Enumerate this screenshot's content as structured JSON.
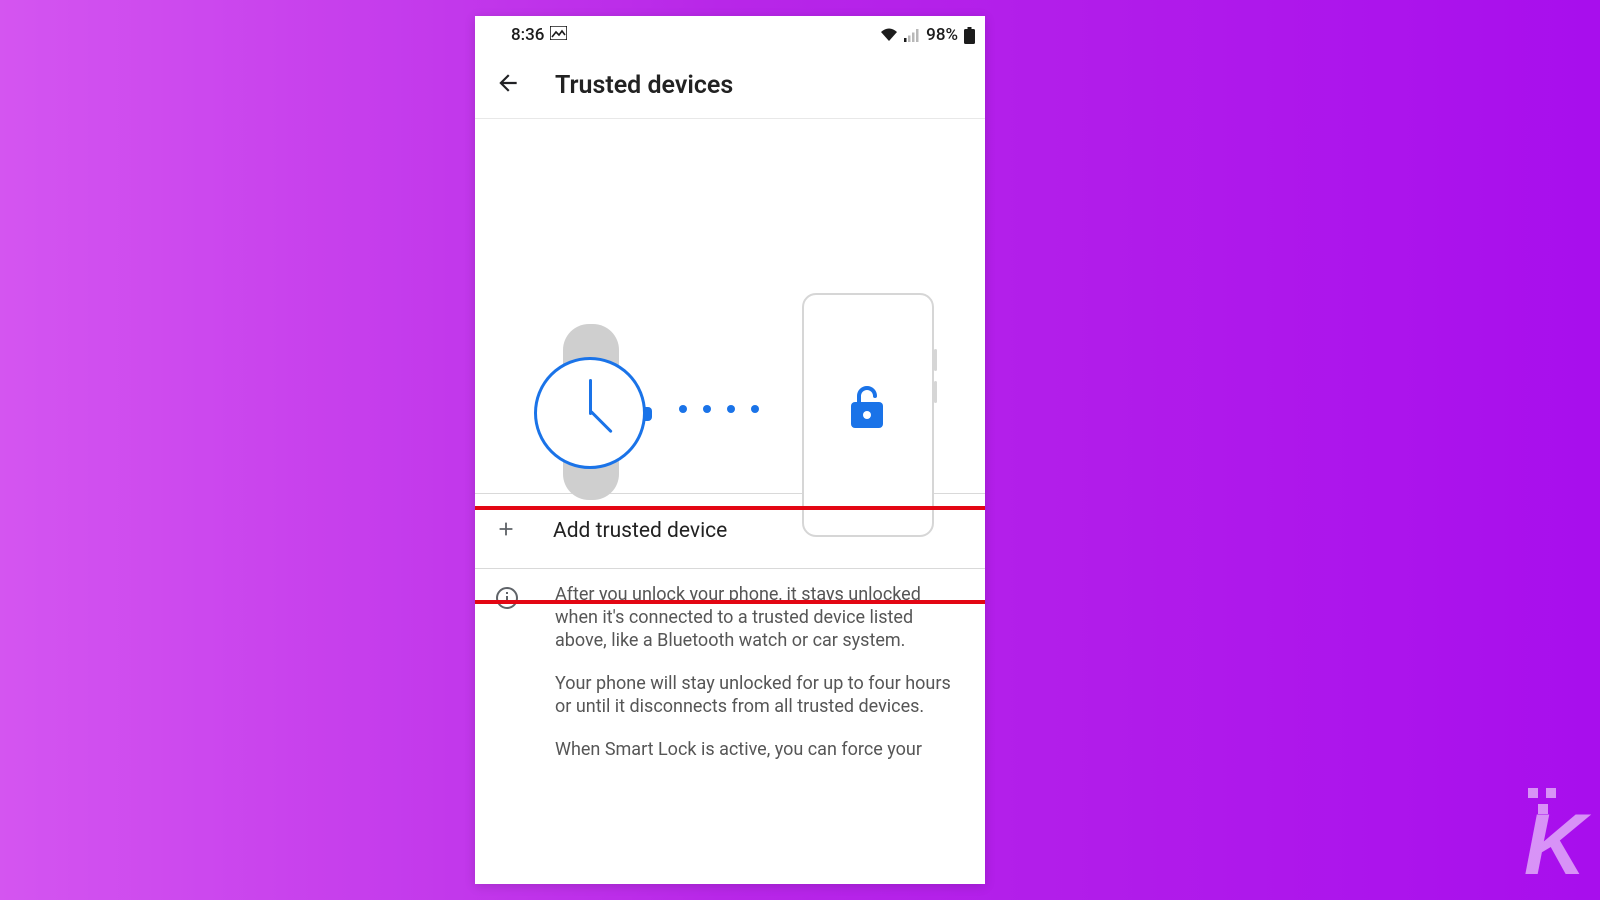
{
  "status": {
    "time": "8:36",
    "battery_pct": "98%"
  },
  "header": {
    "title": "Trusted devices"
  },
  "add_row": {
    "label": "Add trusted device"
  },
  "info": {
    "p1": "After you unlock your phone, it stays unlocked when it's connected to a trusted device listed above, like a Bluetooth watch or car system.",
    "p2": "Your phone will stay unlocked for up to four hours or until it disconnects from all trusted devices.",
    "p3": "When Smart Lock is active, you can force your"
  },
  "watermark": {
    "letter": "K"
  },
  "colors": {
    "accent": "#1a73e8",
    "highlight": "#e30613"
  }
}
